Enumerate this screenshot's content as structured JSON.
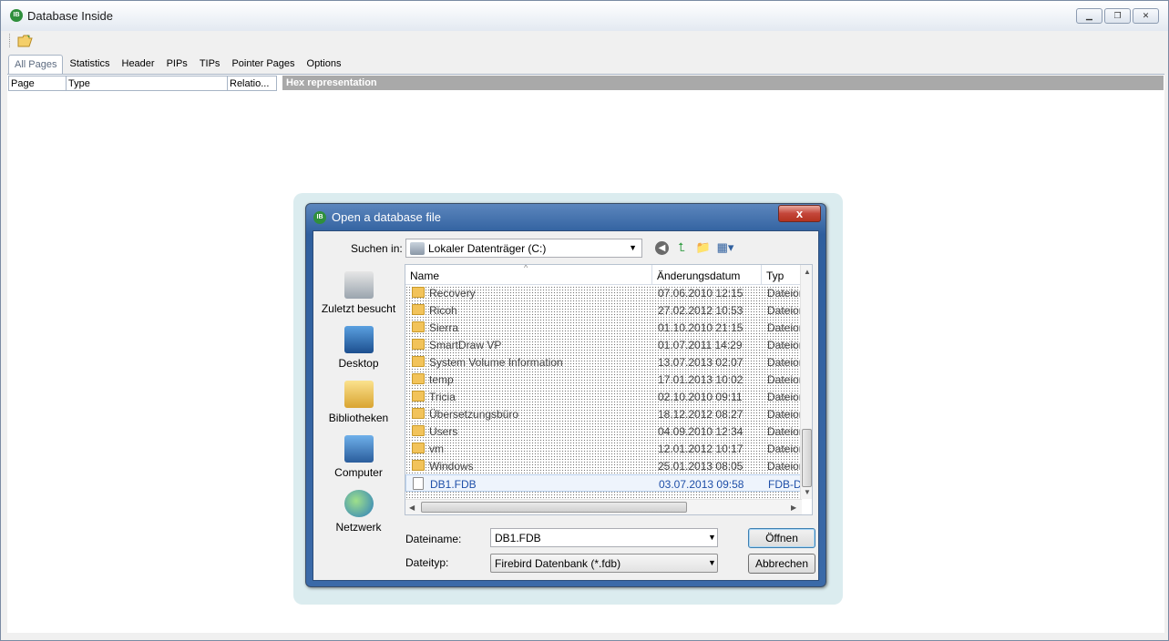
{
  "window": {
    "title": "Database Inside",
    "app_icon": "IB",
    "minimize": "▁",
    "maximize": "❐",
    "close": "✕"
  },
  "tabs": [
    {
      "label": "All Pages",
      "active": true
    },
    {
      "label": "Statistics"
    },
    {
      "label": "Header"
    },
    {
      "label": "PIPs"
    },
    {
      "label": "TIPs"
    },
    {
      "label": "Pointer Pages"
    },
    {
      "label": "Options"
    }
  ],
  "grid": {
    "columns": [
      "Page",
      "Type",
      "Relatio..."
    ],
    "hex_header": "Hex representation"
  },
  "dialog": {
    "title": "Open a database file",
    "close": "x",
    "look_in_label": "Suchen in:",
    "look_in_value": "Lokaler Datenträger (C:)",
    "places": [
      {
        "label": "Zuletzt besucht",
        "icon": "recent-places-icon"
      },
      {
        "label": "Desktop",
        "icon": "desktop-icon"
      },
      {
        "label": "Bibliotheken",
        "icon": "libraries-icon"
      },
      {
        "label": "Computer",
        "icon": "computer-icon"
      },
      {
        "label": "Netzwerk",
        "icon": "network-icon"
      }
    ],
    "columns": {
      "name": "Name",
      "date": "Änderungsdatum",
      "type": "Typ"
    },
    "files": [
      {
        "name": "Recovery",
        "date": "07.06.2010 12:15",
        "type": "Dateior"
      },
      {
        "name": "Ricoh",
        "date": "27.02.2012 10:53",
        "type": "Dateior"
      },
      {
        "name": "Sierra",
        "date": "01.10.2010 21:15",
        "type": "Dateior"
      },
      {
        "name": "SmartDraw VP",
        "date": "01.07.2011 14:29",
        "type": "Dateior"
      },
      {
        "name": "System Volume Information",
        "date": "13.07.2013 02:07",
        "type": "Dateior"
      },
      {
        "name": "temp",
        "date": "17.01.2013 10:02",
        "type": "Dateior"
      },
      {
        "name": "Tricia",
        "date": "02.10.2010 09:11",
        "type": "Dateior"
      },
      {
        "name": "Übersetzungsbüro",
        "date": "18.12.2012 08:27",
        "type": "Dateior"
      },
      {
        "name": "Users",
        "date": "04.09.2010 12:34",
        "type": "Dateior"
      },
      {
        "name": "vm",
        "date": "12.01.2012 10:17",
        "type": "Dateior"
      },
      {
        "name": "Windows",
        "date": "25.01.2013 08:05",
        "type": "Dateior"
      },
      {
        "name": "DB1.FDB",
        "date": "03.07.2013 09:58",
        "type": "FDB-Da",
        "selected": true
      }
    ],
    "filename_label": "Dateiname:",
    "filename_value": "DB1.FDB",
    "filetype_label": "Dateityp:",
    "filetype_value": "Firebird Datenbank (*.fdb)",
    "open_button": "Öffnen",
    "cancel_button": "Abbrechen"
  }
}
